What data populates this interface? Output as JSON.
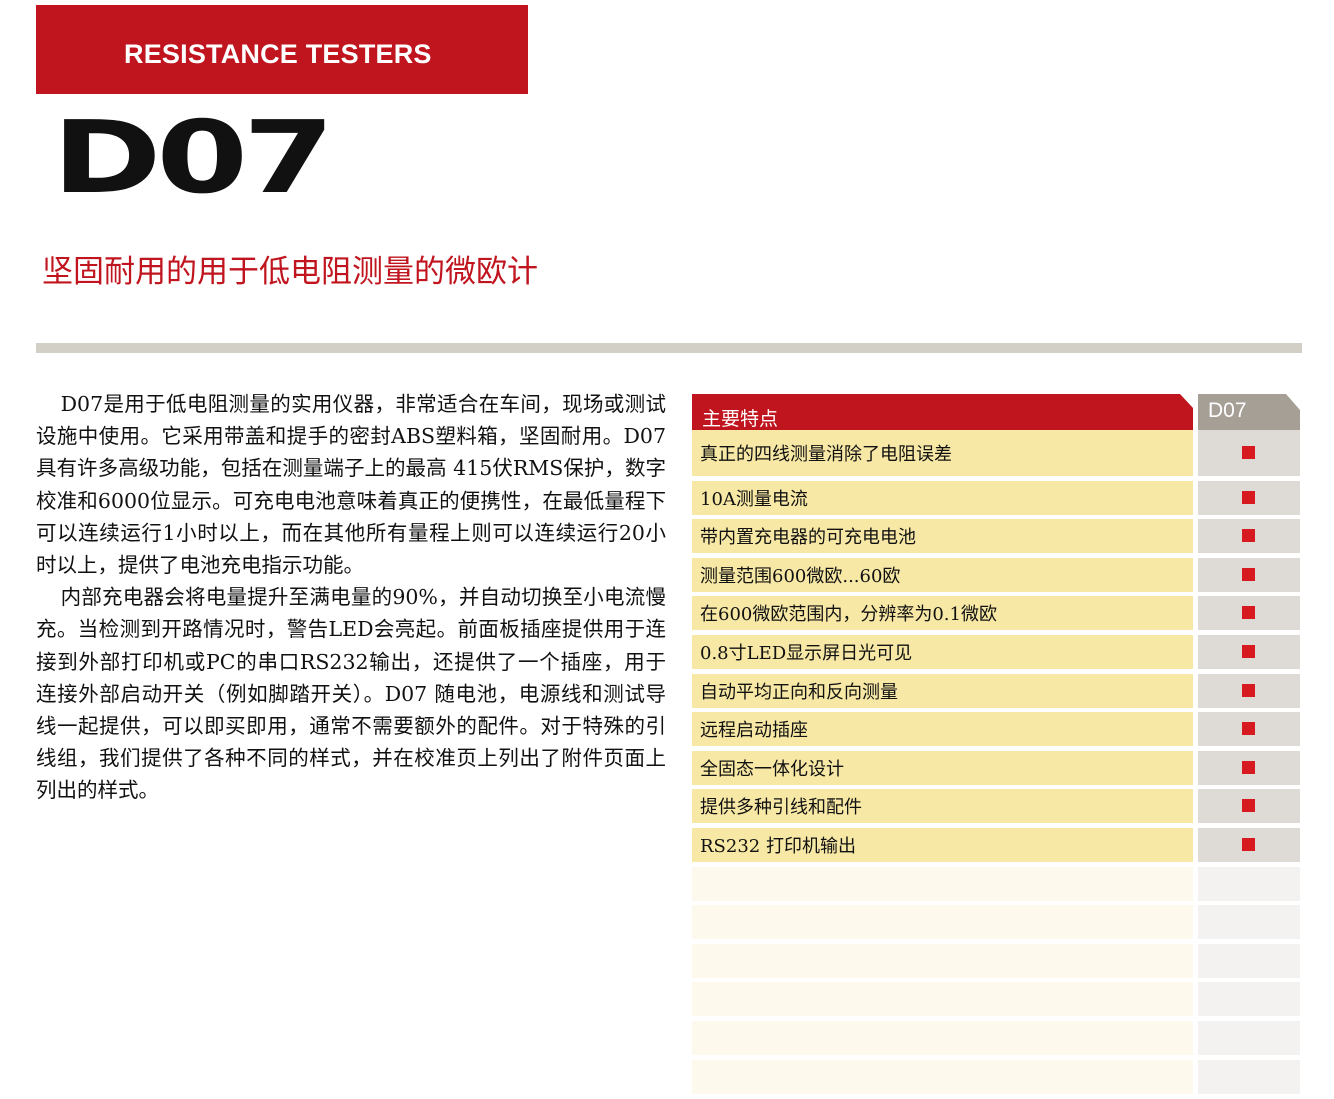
{
  "header": {
    "category": "RESISTANCE TESTERS",
    "model": "D07",
    "subtitle": "坚固耐用的用于低电阻测量的微欧计"
  },
  "description": [
    "D07是用于低电阻测量的实用仪器，非常适合在车间，现场或测试设施中使用。它采用带盖和提手的密封ABS塑料箱，坚固耐用。D07具有许多高级功能，包括在测量端子上的最高 415伏RMS保护，数字校准和6000位显示。可充电电池意味着真正的便携性，在最低量程下可以连续运行1小时以上，而在其他所有量程上则可以连续运行20小时以上，提供了电池充电指示功能。",
    "内部充电器会将电量提升至满电量的90%，并自动切换至小电流慢充。当检测到开路情况时，警告LED会亮起。前面板插座提供用于连接到外部打印机或PC的串口RS232输出，还提供了一个插座，用于连接外部启动开关（例如脚踏开关）。D07 随电池，电源线和测试导线一起提供，可以即买即用，通常不需要额外的配件。对于特殊的引线组，我们提供了各种不同的样式，并在校准页上列出了附件页面上列出的样式。"
  ],
  "features_table": {
    "header_feature": "主要特点",
    "header_model": "D07",
    "rows": [
      "真正的四线测量消除了电阻误差",
      "10A测量电流",
      "带内置充电器的可充电电池",
      "测量范围600微欧...60欧",
      "在600微欧范围内，分辨率为0.1微欧",
      "0.8寸LED显示屏日光可见",
      "自动平均正向和反向测量",
      "远程启动插座",
      "全固态一体化设计",
      "提供多种引线和配件",
      "RS232 打印机输出"
    ],
    "blank_rows": 6,
    "mark_icon": "red-square-icon"
  },
  "colors": {
    "brand_red": "#c0141e",
    "row_yellow": "#f7e8a5",
    "model_column_gray": "#dedbd6",
    "rule_gray": "#d2cfc7"
  }
}
